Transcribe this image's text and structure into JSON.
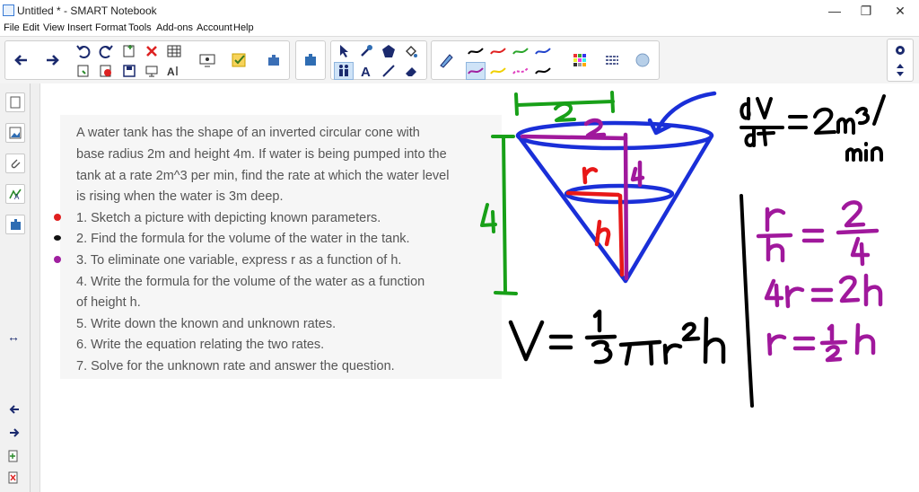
{
  "window": {
    "title": "Untitled * - SMART Notebook",
    "controls": {
      "minimize": "—",
      "maximize": "❐",
      "close": "✕"
    }
  },
  "menu": [
    "File",
    "Edit",
    "View",
    "Insert",
    "Format",
    "Tools",
    "Add-ons",
    "Account",
    "Help"
  ],
  "toolbar": {
    "icons": [
      "back-arrow-icon",
      "forward-arrow-icon",
      "undo-icon",
      "redo-icon",
      "add-page-icon",
      "delete-icon",
      "table-icon",
      "screen-shade-icon",
      "check-icon",
      "add-on-icon",
      "settings-icon",
      "select-icon",
      "magic-pen-icon",
      "shapes-icon",
      "fill-icon",
      "text-icon",
      "line-icon",
      "eraser-icon",
      "pen-icon"
    ],
    "pen_colors": [
      "#000000",
      "#e02020",
      "#2aa52a",
      "#2244cc",
      "#a020a0",
      "#f0d000",
      "#e040c0",
      "#000000"
    ]
  },
  "question": {
    "lines": [
      "A water tank has the shape of an inverted circular cone with",
      "base radius 2m and height 4m. If water is being pumped into the",
      "tank at a rate 2m^3 per min, find the rate at which the water level",
      "is rising when the water is 3m deep."
    ],
    "steps": [
      {
        "text": "1. Sketch a picture with depicting known parameters.",
        "bullet": "#e02020"
      },
      {
        "text": "2. Find the formula for the volume of the water in the tank.",
        "bullet": "#111111"
      },
      {
        "text": "3. To eliminate one variable, express r as a function of h.",
        "bullet": "#a020a0"
      },
      {
        "text": "4. Write the formula for the volume of the water as a function",
        "bullet": ""
      },
      {
        "text": "of height h.",
        "bullet": ""
      },
      {
        "text": "5. Write down the known and unknown rates.",
        "bullet": ""
      },
      {
        "text": "6. Write the equation relating the two rates.",
        "bullet": ""
      },
      {
        "text": "7. Solve for the unknown rate and answer the question.",
        "bullet": ""
      }
    ]
  },
  "handwriting": {
    "colors": {
      "green": "#18a018",
      "blue": "#1a2fd8",
      "purple": "#a0189c",
      "red": "#e81818",
      "black": "#000000"
    }
  }
}
